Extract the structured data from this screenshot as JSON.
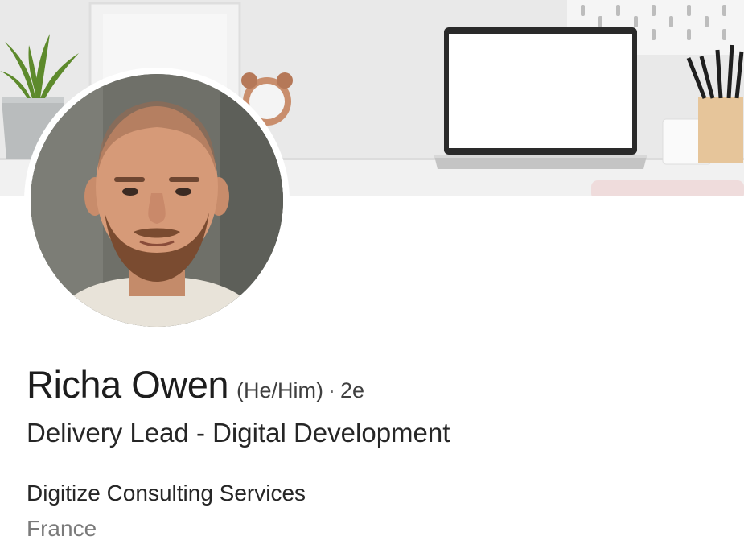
{
  "profile": {
    "name": "Richa Owen",
    "pronouns": "(He/Him)",
    "separator": "·",
    "connection_degree": "2e",
    "headline": "Delivery Lead - Digital Development",
    "company": "Digitize Consulting Services",
    "location": "France"
  },
  "colors": {
    "text_primary": "#1d1d1d",
    "text_secondary": "#7a7a7a",
    "cover_background": "#e6e6e6",
    "avatar_border": "#ffffff"
  },
  "icons": {
    "cover": "desk-workspace-illustration",
    "avatar": "profile-photo"
  }
}
